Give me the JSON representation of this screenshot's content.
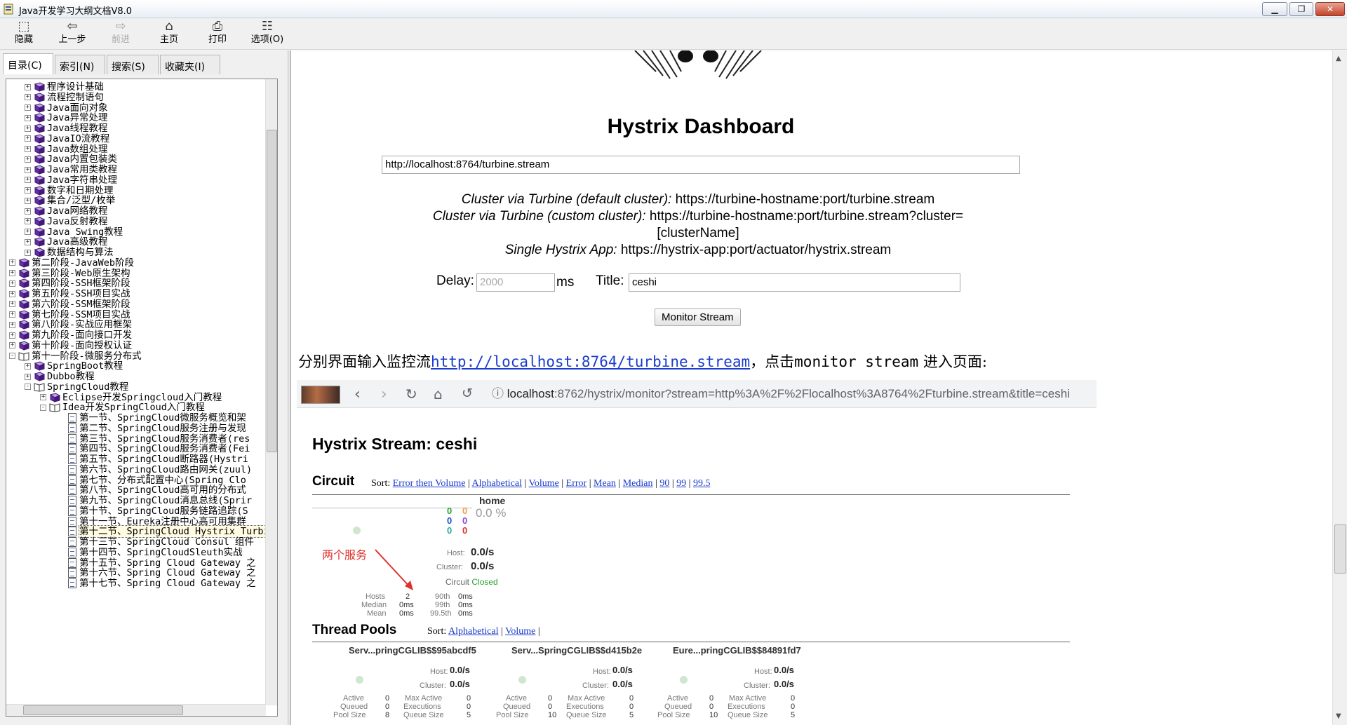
{
  "window": {
    "title": "Java开发学习大纲文档V8.0",
    "controls": {
      "minimize": "▁",
      "maximize": "❐",
      "close": "✕"
    }
  },
  "toolbar": [
    {
      "label": "隐藏",
      "icon": "hide-pane-icon",
      "glyph": "⬚",
      "enabled": true
    },
    {
      "label": "上一步",
      "icon": "back-arrow-icon",
      "glyph": "⇦",
      "enabled": true
    },
    {
      "label": "前进",
      "icon": "forward-arrow-icon",
      "glyph": "⇨",
      "enabled": false
    },
    {
      "label": "主页",
      "icon": "home-icon",
      "glyph": "⌂",
      "enabled": true
    },
    {
      "label": "打印",
      "icon": "printer-icon",
      "glyph": "⎙",
      "enabled": true
    },
    {
      "label": "选项(O)",
      "icon": "options-icon",
      "glyph": "☷",
      "enabled": true
    }
  ],
  "tabs": [
    "目录(C)",
    "索引(N)",
    "搜索(S)",
    "收藏夹(I)"
  ],
  "tree": [
    {
      "level": 1,
      "text": "程序设计基础",
      "icon": "book",
      "pm": "+"
    },
    {
      "level": 1,
      "text": "流程控制语句",
      "icon": "book",
      "pm": "+"
    },
    {
      "level": 1,
      "text": "Java面向对象",
      "icon": "book",
      "pm": "+"
    },
    {
      "level": 1,
      "text": "Java异常处理",
      "icon": "book",
      "pm": "+"
    },
    {
      "level": 1,
      "text": "Java线程教程",
      "icon": "book",
      "pm": "+"
    },
    {
      "level": 1,
      "text": "JavaIO流教程",
      "icon": "book",
      "pm": "+"
    },
    {
      "level": 1,
      "text": "Java数组处理",
      "icon": "book",
      "pm": "+"
    },
    {
      "level": 1,
      "text": "Java内置包装类",
      "icon": "book",
      "pm": "+"
    },
    {
      "level": 1,
      "text": "Java常用类教程",
      "icon": "book",
      "pm": "+"
    },
    {
      "level": 1,
      "text": "Java字符串处理",
      "icon": "book",
      "pm": "+"
    },
    {
      "level": 1,
      "text": "数字和日期处理",
      "icon": "book",
      "pm": "+"
    },
    {
      "level": 1,
      "text": "集合/泛型/枚举",
      "icon": "book",
      "pm": "+"
    },
    {
      "level": 1,
      "text": "Java网络教程",
      "icon": "book",
      "pm": "+"
    },
    {
      "level": 1,
      "text": "Java反射教程",
      "icon": "book",
      "pm": "+"
    },
    {
      "level": 1,
      "text": "Java Swing教程",
      "icon": "book",
      "pm": "+"
    },
    {
      "level": 1,
      "text": "Java高级教程",
      "icon": "book",
      "pm": "+"
    },
    {
      "level": 1,
      "text": "数据结构与算法",
      "icon": "book",
      "pm": "+"
    },
    {
      "level": 0,
      "text": "第二阶段-JavaWeb阶段",
      "icon": "book",
      "pm": "+"
    },
    {
      "level": 0,
      "text": "第三阶段-Web原生架构",
      "icon": "book",
      "pm": "+"
    },
    {
      "level": 0,
      "text": "第四阶段-SSH框架阶段",
      "icon": "book",
      "pm": "+"
    },
    {
      "level": 0,
      "text": "第五阶段-SSH项目实战",
      "icon": "book",
      "pm": "+"
    },
    {
      "level": 0,
      "text": "第六阶段-SSM框架阶段",
      "icon": "book",
      "pm": "+"
    },
    {
      "level": 0,
      "text": "第七阶段-SSM项目实战",
      "icon": "book",
      "pm": "+"
    },
    {
      "level": 0,
      "text": "第八阶段-实战应用框架",
      "icon": "book",
      "pm": "+"
    },
    {
      "level": 0,
      "text": "第九阶段-面向接口开发",
      "icon": "book",
      "pm": "+"
    },
    {
      "level": 0,
      "text": "第十阶段-面向授权认证",
      "icon": "book",
      "pm": "+"
    },
    {
      "level": 0,
      "text": "第十一阶段-微服务分布式",
      "icon": "open-book",
      "pm": "-"
    },
    {
      "level": 1,
      "text": "SpringBoot教程",
      "icon": "book",
      "pm": "+"
    },
    {
      "level": 1,
      "text": "Dubbo教程",
      "icon": "book",
      "pm": "+"
    },
    {
      "level": 1,
      "text": "SpringCloud教程",
      "icon": "open-book",
      "pm": "-"
    },
    {
      "level": 2,
      "text": "Eclipse开发Springcloud入门教程",
      "icon": "book",
      "pm": "+"
    },
    {
      "level": 2,
      "text": "Idea开发SpringCloud入门教程",
      "icon": "open-book",
      "pm": "-"
    },
    {
      "level": 3,
      "text": "第一节、SpringCloud微服务概览和架",
      "icon": "page"
    },
    {
      "level": 3,
      "text": "第二节、SpringCloud服务注册与发现",
      "icon": "page"
    },
    {
      "level": 3,
      "text": "第三节、SpringCloud服务消费者(res",
      "icon": "page"
    },
    {
      "level": 3,
      "text": "第四节、SpringCloud服务消费者(Fei",
      "icon": "page"
    },
    {
      "level": 3,
      "text": "第五节、SpringCloud断路器(Hystri",
      "icon": "page"
    },
    {
      "level": 3,
      "text": "第六节、SpringCloud路由网关(zuul)",
      "icon": "page"
    },
    {
      "level": 3,
      "text": "第七节、分布式配置中心(Spring Clo",
      "icon": "page"
    },
    {
      "level": 3,
      "text": "第八节、SpringCloud高可用的分布式",
      "icon": "page"
    },
    {
      "level": 3,
      "text": "第九节、SpringCloud消息总线(Sprir",
      "icon": "page"
    },
    {
      "level": 3,
      "text": "第十节、SpringCloud服务链路追踪(S",
      "icon": "page"
    },
    {
      "level": 3,
      "text": "第十一节、Eureka注册中心高可用集群",
      "icon": "page"
    },
    {
      "level": 3,
      "text": "第十二节、SpringCloud Hystrix Turbine",
      "icon": "page",
      "selected": true
    },
    {
      "level": 3,
      "text": "第十三节、SpringCloud Consul 组件",
      "icon": "page"
    },
    {
      "level": 3,
      "text": "第十四节、SpringCloudSleuth实战",
      "icon": "page"
    },
    {
      "level": 3,
      "text": "第十五节、Spring Cloud Gateway 之",
      "icon": "page"
    },
    {
      "level": 3,
      "text": "第十六节、Spring Cloud Gateway 之",
      "icon": "page"
    },
    {
      "level": 3,
      "text": "第十七节、Spring Cloud Gateway 之",
      "icon": "page"
    }
  ],
  "hystrix": {
    "title": "Hystrix Dashboard",
    "stream_url": "http://localhost:8764/turbine.stream",
    "help1_label": "Cluster via Turbine (default cluster):",
    "help1_value": "https://turbine-hostname:port/turbine.stream",
    "help2_label": "Cluster via Turbine (custom cluster):",
    "help2_value": "https://turbine-hostname:port/turbine.stream?cluster=",
    "help2_value2": "[clusterName]",
    "help3_label": "Single Hystrix App:",
    "help3_value": "https://hystrix-app:port/actuator/hystrix.stream",
    "delay_label": "Delay:",
    "delay_placeholder": "2000",
    "delay_unit": "ms",
    "title_label": "Title:",
    "title_value": "ceshi",
    "monitor_button": "Monitor Stream"
  },
  "paragraph": {
    "prefix": "分别界面输入监控流",
    "link": "http://localhost:8764/turbine.stream",
    "middle": "，点击",
    "mono": "monitor stream",
    "suffix": " 进入页面:"
  },
  "browser": {
    "url_host": "localhost",
    "url_rest": ":8762/hystrix/monitor?stream=http%3A%2F%2Flocalhost%3A8764%2Fturbine.stream&title=ceshi"
  },
  "monitor": {
    "title": "Hystrix Stream: ceshi",
    "circuit_label": "Circuit",
    "sort_label": "Sort:",
    "circuit_sorts": [
      "Error then Volume",
      "Alphabetical",
      "Volume",
      "Error",
      "Mean",
      "Median",
      "90",
      "99",
      "99.5"
    ],
    "circuit": {
      "name": "home",
      "counts_green": [
        "0",
        "0",
        "0"
      ],
      "counts_mid": [
        "0",
        "0",
        "0"
      ],
      "error_pct": "0.0 %",
      "host_label": "Host:",
      "host_rate": "0.0/s",
      "cluster_label": "Cluster:",
      "cluster_rate": "0.0/s",
      "circuit_text": "Circuit",
      "circuit_state": "Closed",
      "hosts_label": "Hosts",
      "hosts_value": "2",
      "median_label": "Median",
      "median_value": "0ms",
      "mean_label": "Mean",
      "mean_value": "0ms",
      "p90_label": "90th",
      "p90_value": "0ms",
      "p99_label": "99th",
      "p99_value": "0ms",
      "p995_label": "99.5th",
      "p995_value": "0ms"
    },
    "annotation": "两个服务",
    "threadpools_label": "Thread Pools",
    "pool_sorts": [
      "Alphabetical",
      "Volume"
    ],
    "pools": [
      {
        "name": "Serv...pringCGLIB$$95abcdf5",
        "active": "0",
        "queued": "0",
        "pool_size": "8",
        "max_active": "0",
        "executions": "0",
        "queue_size": "5"
      },
      {
        "name": "Serv...SpringCGLIB$$d415b2e",
        "active": "0",
        "queued": "0",
        "pool_size": "10",
        "max_active": "0",
        "executions": "0",
        "queue_size": "5"
      },
      {
        "name": "Eure...pringCGLIB$$84891fd7",
        "active": "0",
        "queued": "0",
        "pool_size": "10",
        "max_active": "0",
        "executions": "0",
        "queue_size": "5"
      }
    ],
    "pool_labels": {
      "host": "Host:",
      "cluster": "Cluster:",
      "rate": "0.0/s",
      "active": "Active",
      "queued": "Queued",
      "pool_size": "Pool Size",
      "max_active": "Max Active",
      "executions": "Executions",
      "queue_size": "Queue Size"
    }
  },
  "colors": {
    "link": "#1a3ccc",
    "green": "#2ca02c",
    "blue": "#1f4fd1",
    "teal": "#2aa8a0",
    "orange": "#e8a33c",
    "purple": "#8a4ad0",
    "red": "#e0302a",
    "closed": "#2ca02c",
    "annotation": "#e0302a"
  }
}
